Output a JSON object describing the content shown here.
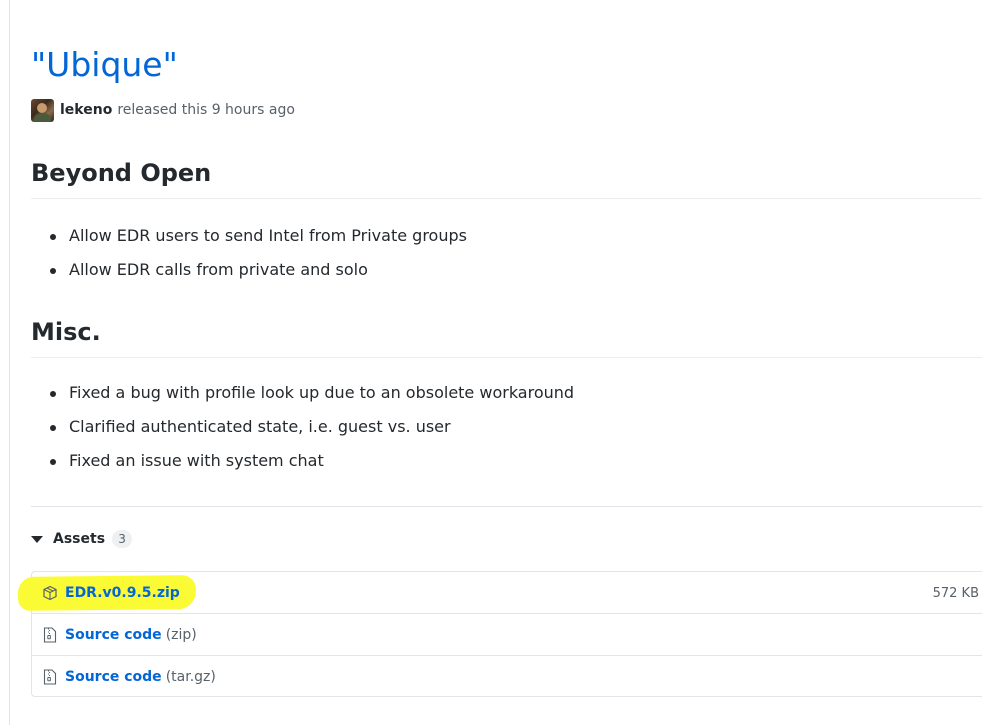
{
  "release": {
    "title": "\"Ubique\"",
    "author": "lekeno",
    "released_text": "released this 9 hours ago"
  },
  "sections": [
    {
      "heading": "Beyond Open",
      "items": [
        "Allow EDR users to send Intel from Private groups",
        "Allow EDR calls from private and solo"
      ]
    },
    {
      "heading": "Misc.",
      "items": [
        "Fixed a bug with profile look up due to an obsolete workaround",
        "Clarified authenticated state, i.e. guest vs. user",
        "Fixed an issue with system chat"
      ]
    }
  ],
  "assets": {
    "label": "Assets",
    "count": "3",
    "files": [
      {
        "name": "EDR.v0.9.5.zip",
        "ext": "",
        "size": "572 KB",
        "icon": "package-icon"
      },
      {
        "name": "Source code",
        "ext": "(zip)",
        "size": "",
        "icon": "file-zip-icon"
      },
      {
        "name": "Source code",
        "ext": "(tar.gz)",
        "size": "",
        "icon": "file-zip-icon"
      }
    ]
  },
  "colors": {
    "link": "#0366d6",
    "text": "#24292e",
    "muted": "#586069",
    "highlight": "#fbfb2a"
  }
}
